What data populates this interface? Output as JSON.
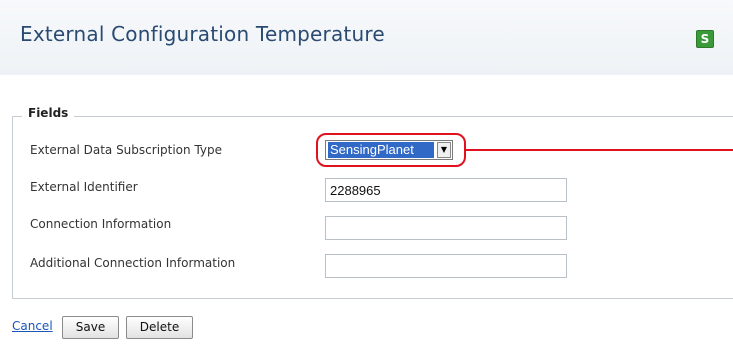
{
  "page": {
    "title": "External Configuration Temperature",
    "refresh_icon": "refresh-icon",
    "refresh_symbol": "S"
  },
  "fields": {
    "legend": "Fields",
    "subscription_type": {
      "label": "External Data Subscription Type",
      "selected": "SensingPlanet"
    },
    "external_identifier": {
      "label": "External Identifier",
      "value": "2288965"
    },
    "connection_information": {
      "label": "Connection Information",
      "value": ""
    },
    "additional_connection_information": {
      "label": "Additional Connection Information",
      "value": ""
    }
  },
  "actions": {
    "cancel": "Cancel",
    "save": "Save",
    "delete": "Delete"
  },
  "colors": {
    "title": "#2a4a72",
    "callout": "#e0121f",
    "selection": "#3169c6",
    "refresh": "#3a9a3a"
  }
}
